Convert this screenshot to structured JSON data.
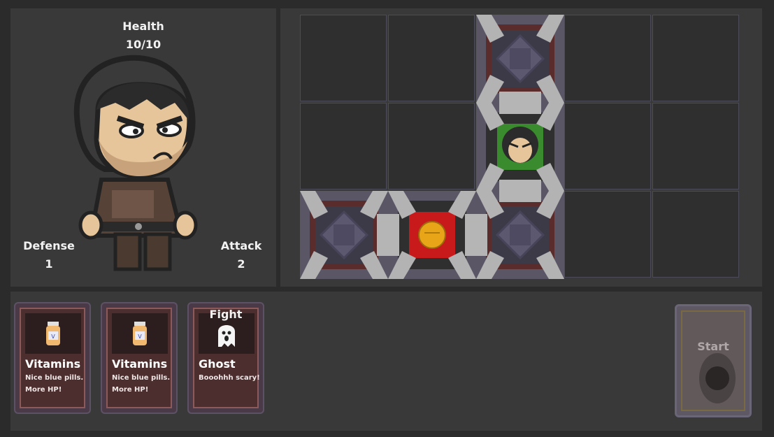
{
  "stats": {
    "health_label": "Health",
    "health_value": "10/10",
    "defense_label": "Defense",
    "defense_value": "1",
    "attack_label": "Attack",
    "attack_value": "2"
  },
  "board": {
    "columns": 5,
    "rows": 3
  },
  "hand": {
    "cards": [
      {
        "title": "Vitamins",
        "desc": "Nice blue pills. More HP!",
        "icon": "pill-bottle-icon"
      },
      {
        "title": "Vitamins",
        "desc": "Nice blue pills. More HP!",
        "icon": "pill-bottle-icon"
      },
      {
        "title": "Ghost",
        "desc": "Booohhh scary!",
        "tag": "Fight",
        "icon": "ghost-icon"
      }
    ],
    "deck_label": "Start"
  },
  "colors": {
    "background": "#2b2b2b",
    "panel": "#393939",
    "grid_line": "#4b4b5a",
    "card_bg": "#4d2e2e",
    "card_border": "#8c5a5a",
    "hero_room": "#3a8a2e",
    "enemy_room": "#c81a1a",
    "enemy_marker": "#e8a517"
  }
}
